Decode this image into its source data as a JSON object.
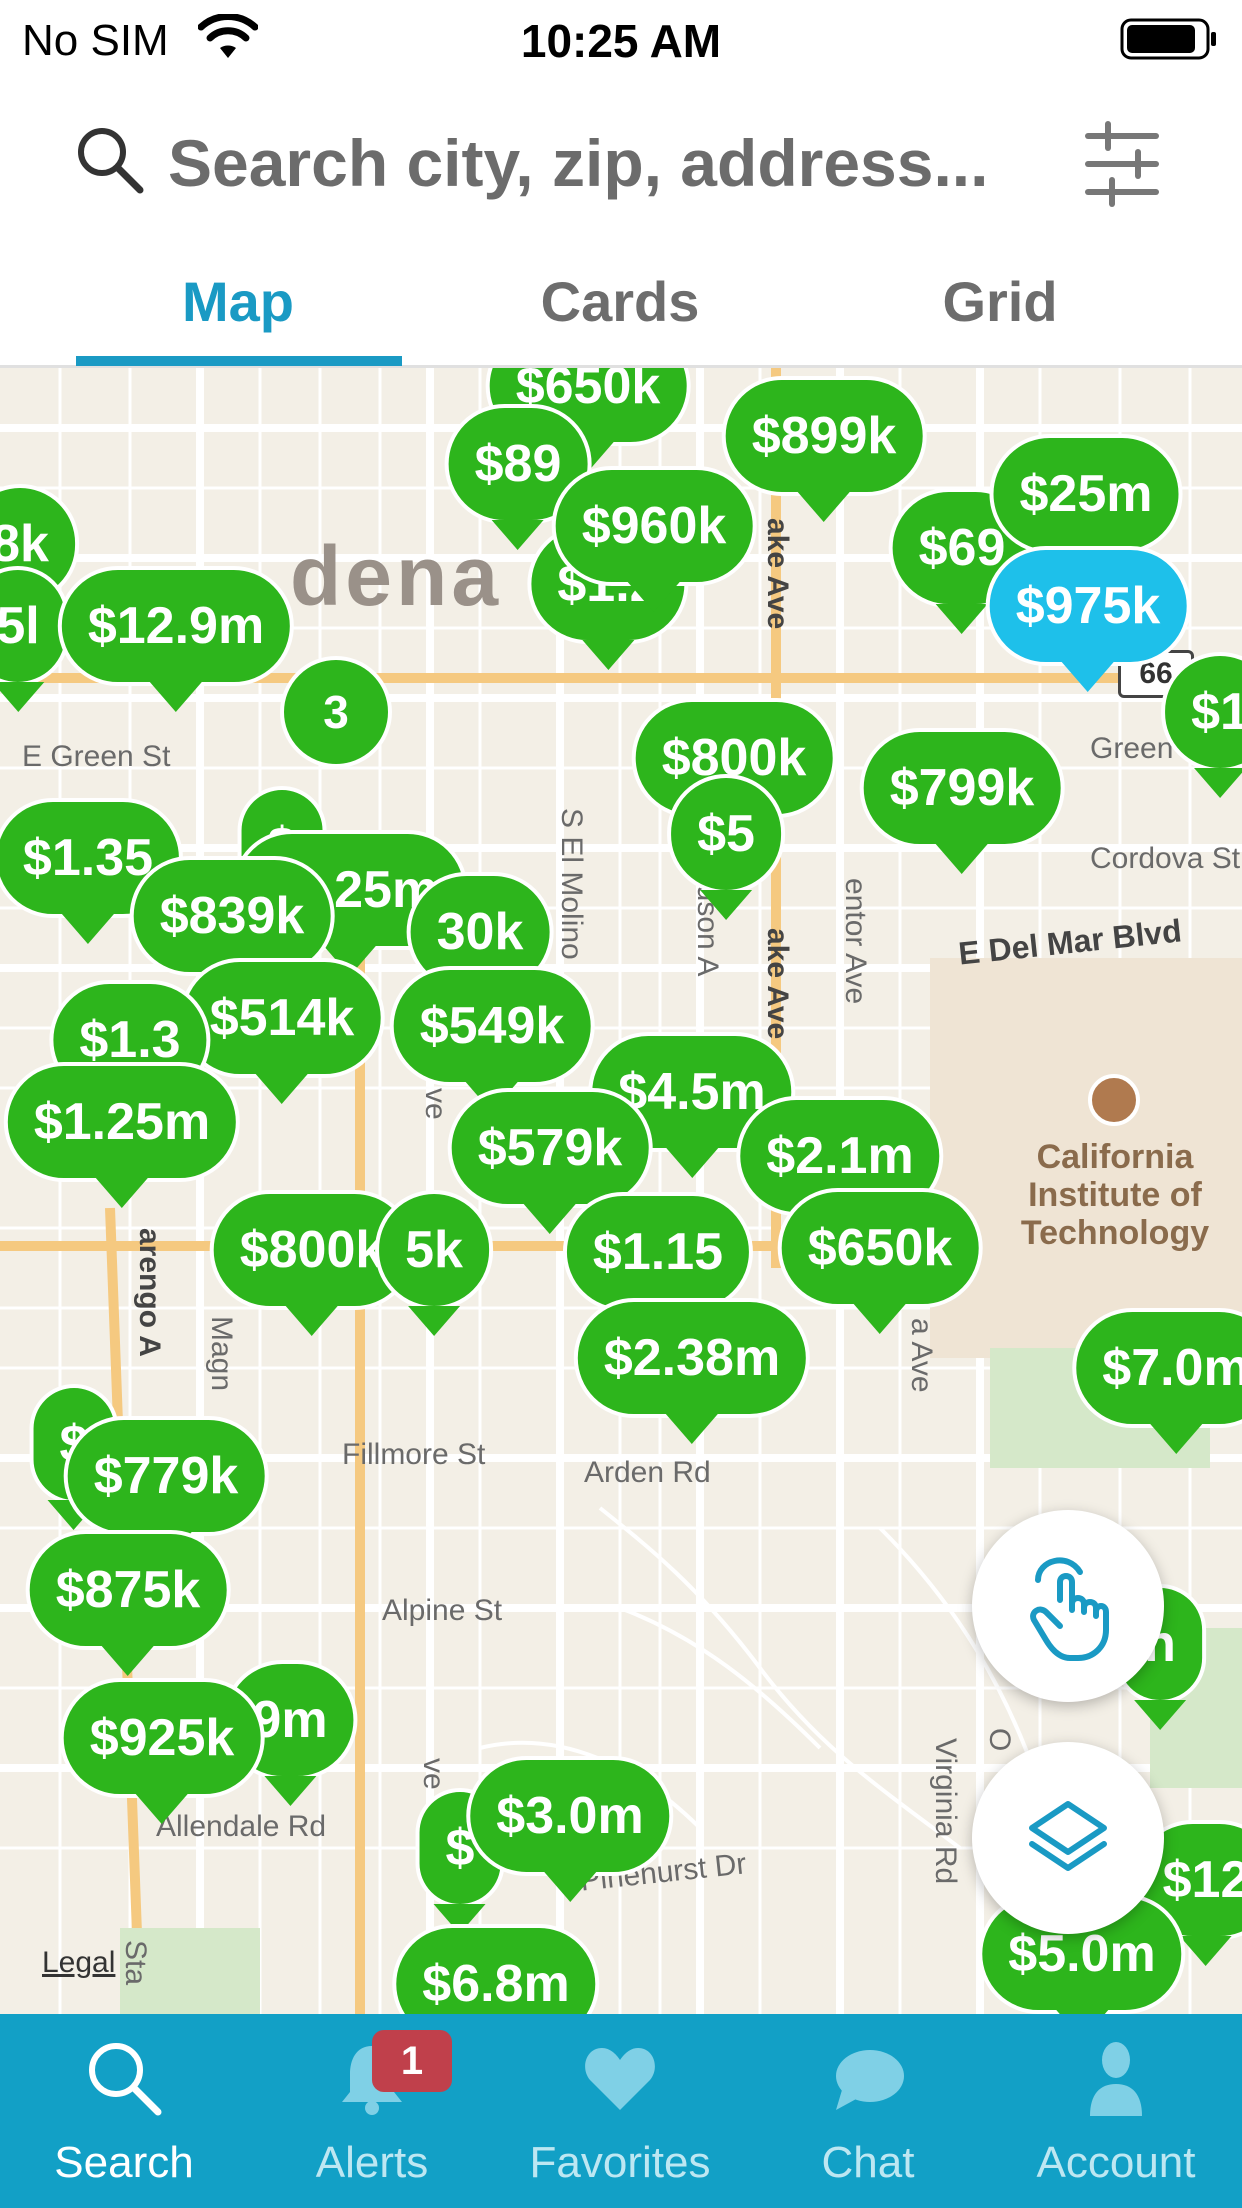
{
  "status_bar": {
    "carrier": "No SIM",
    "time": "10:25 AM"
  },
  "search": {
    "placeholder": "Search city, zip, address..."
  },
  "tabs": [
    {
      "label": "Map",
      "active": true
    },
    {
      "label": "Cards",
      "active": false
    },
    {
      "label": "Grid",
      "active": false
    }
  ],
  "map": {
    "city_name": "dena",
    "streets": [
      "E Green St",
      "Green St",
      "Cordova St",
      "E Del Mar Blvd",
      "S El Molino",
      "udson A",
      "ake Ave",
      "ake Ave",
      "entor Ave",
      "arengo A",
      "Magn",
      "Fillmore St",
      "Arden Rd",
      "Alpine St",
      "Allendale Rd",
      "Pinehurst Dr",
      "Virginia Rd",
      "a Ave",
      "ve",
      "ve",
      "O",
      "Sta"
    ],
    "poi": {
      "name": "California Institute of Technology"
    },
    "route_shield": "66",
    "legal": "Legal",
    "pins": [
      {
        "label": "$650k",
        "color": "green"
      },
      {
        "label": "$89",
        "color": "green"
      },
      {
        "label": "$899k",
        "color": "green"
      },
      {
        "label": "$1.2",
        "color": "green"
      },
      {
        "label": "$960k",
        "color": "green"
      },
      {
        "label": "$69",
        "color": "green"
      },
      {
        "label": "$25m",
        "color": "green"
      },
      {
        "label": "$975k",
        "color": "blue"
      },
      {
        "label": "8k",
        "color": "green"
      },
      {
        "label": "5l",
        "color": "green"
      },
      {
        "label": "$12.9m",
        "color": "green"
      },
      {
        "label": "3",
        "color": "green"
      },
      {
        "label": "$1",
        "color": "green"
      },
      {
        "label": "$800k",
        "color": "green"
      },
      {
        "label": "$5",
        "color": "green"
      },
      {
        "label": "$799k",
        "color": "green"
      },
      {
        "label": "$1.35",
        "color": "green"
      },
      {
        "label": "$",
        "color": "green"
      },
      {
        "label": "$1.25m",
        "color": "green"
      },
      {
        "label": "$839k",
        "color": "green"
      },
      {
        "label": "30k",
        "color": "green"
      },
      {
        "label": "$514k",
        "color": "green"
      },
      {
        "label": "$549k",
        "color": "green"
      },
      {
        "label": "$1.3",
        "color": "green"
      },
      {
        "label": "$4.5m",
        "color": "green"
      },
      {
        "label": "$1.25m",
        "color": "green"
      },
      {
        "label": "$579k",
        "color": "green"
      },
      {
        "label": "$2.1m",
        "color": "green"
      },
      {
        "label": "$800k",
        "color": "green"
      },
      {
        "label": "5k",
        "color": "green"
      },
      {
        "label": "$1.15",
        "color": "green"
      },
      {
        "label": "$650k",
        "color": "green"
      },
      {
        "label": "$2.38m",
        "color": "green"
      },
      {
        "label": "$7.0m",
        "color": "green"
      },
      {
        "label": "$",
        "color": "green"
      },
      {
        "label": "$779k",
        "color": "green"
      },
      {
        "label": "$875k",
        "color": "green"
      },
      {
        "label": "9m",
        "color": "green"
      },
      {
        "label": "$925k",
        "color": "green"
      },
      {
        "label": "n",
        "color": "green"
      },
      {
        "label": "$",
        "color": "green"
      },
      {
        "label": "$3.0m",
        "color": "green"
      },
      {
        "label": "$12",
        "color": "green"
      },
      {
        "label": "$5.0m",
        "color": "green"
      },
      {
        "label": "$6.8m",
        "color": "green"
      }
    ]
  },
  "bottom_nav": [
    {
      "label": "Search",
      "icon": "search-icon",
      "active": true
    },
    {
      "label": "Alerts",
      "icon": "bell-icon",
      "active": false,
      "badge": "1"
    },
    {
      "label": "Favorites",
      "icon": "heart-icon",
      "active": false
    },
    {
      "label": "Chat",
      "icon": "chat-bubble-icon",
      "active": false
    },
    {
      "label": "Account",
      "icon": "person-icon",
      "active": false
    }
  ],
  "colors": {
    "accent": "#1a9ac4",
    "pin_green": "#2db51c",
    "pin_blue": "#1ec0ea",
    "nav_bg": "#12a0c6",
    "badge": "#c0404b"
  }
}
